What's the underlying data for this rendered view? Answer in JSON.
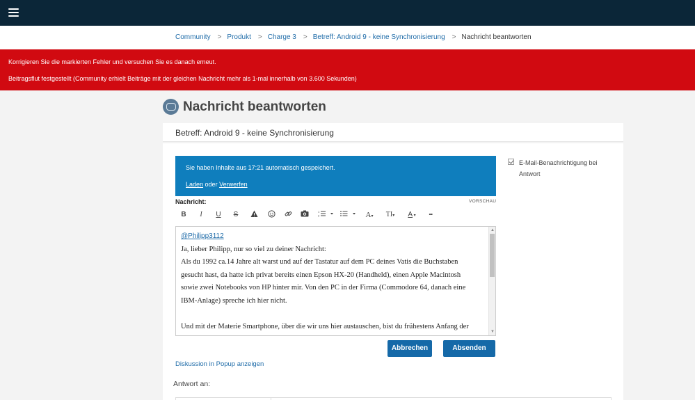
{
  "topbar": {
    "menu_icon": "hamburger-menu-icon"
  },
  "breadcrumb": {
    "items": [
      "Community",
      "Produkt",
      "Charge 3",
      "Betreff: Android 9 - keine Synchronisierung"
    ],
    "separator": ">",
    "current": "Nachricht beantworten"
  },
  "errors": {
    "line1": "Korrigieren Sie die markierten Fehler und versuchen Sie es danach erneut.",
    "line2": "Beitragsflut festgestellt (Community erhielt Beiträge mit der gleichen Nachricht mehr als 1-mal innerhalb von 3.600 Sekunden)"
  },
  "page": {
    "title": "Nachricht beantworten",
    "subject": "Betreff: Android 9 - keine Synchronisierung"
  },
  "autosave": {
    "message": "Sie haben Inhalte aus 17:21 automatisch gespeichert.",
    "load": "Laden",
    "or": "oder",
    "discard": "Verwerfen"
  },
  "notification": {
    "checked": true,
    "label": "E-Mail-Benachrichtigung bei Antwort"
  },
  "editor": {
    "label": "Nachricht:",
    "preview": "VORSCHAU",
    "toolbar_icons": [
      "bold-icon",
      "italic-icon",
      "underline-icon",
      "strikethrough-icon",
      "warning-icon",
      "emoji-icon",
      "link-icon",
      "camera-icon",
      "ordered-list-icon",
      "unordered-list-icon",
      "font-family-icon",
      "font-size-icon",
      "font-color-icon",
      "more-icon"
    ],
    "toolbar_labels": {
      "bold": "B",
      "italic": "I",
      "underline": "U",
      "strike": "S",
      "font": "A",
      "size": "TI",
      "color": "A",
      "more": "•••"
    },
    "mention": "@Philipp3112",
    "lines": [
      "Ja, lieber Philipp, nur so viel zu deiner Nachricht:",
      "Als du 1992 ca.14 Jahre alt warst und auf der Tastatur auf dem PC deines Vatis die Buchstaben",
      "gesucht hast, da hatte ich privat bereits einen Epson HX-20 (Handheld), einen Apple Macintosh",
      "sowie zwei Notebooks von HP hinter mir. Von den PC in der Firma (Commodore 64, danach eine",
      "IBM-Anlage) spreche ich hier nicht.",
      "",
      "Und mit der Materie Smartphone, über die wir uns hier austauschen, bist du frühestens Anfang der"
    ]
  },
  "buttons": {
    "cancel": "Abbrechen",
    "send": "Absenden"
  },
  "links": {
    "popup": "Diskussion in Popup anzeigen"
  },
  "reply": {
    "label": "Antwort an:"
  }
}
